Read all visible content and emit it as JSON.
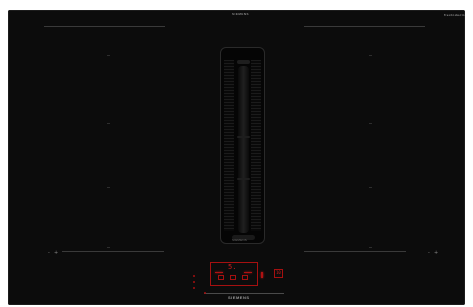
{
  "appliance": {
    "top_center_label": "SIEMENS",
    "top_right_logo": "flexInduction",
    "bottom_brand": "SIEMENS",
    "vent_label": "SIEMENS"
  },
  "control_panel": {
    "main_display": "5.",
    "timer_display": "10"
  },
  "indicators": {
    "accent_color": "#c01818",
    "glass_color": "#0c0c0c"
  }
}
